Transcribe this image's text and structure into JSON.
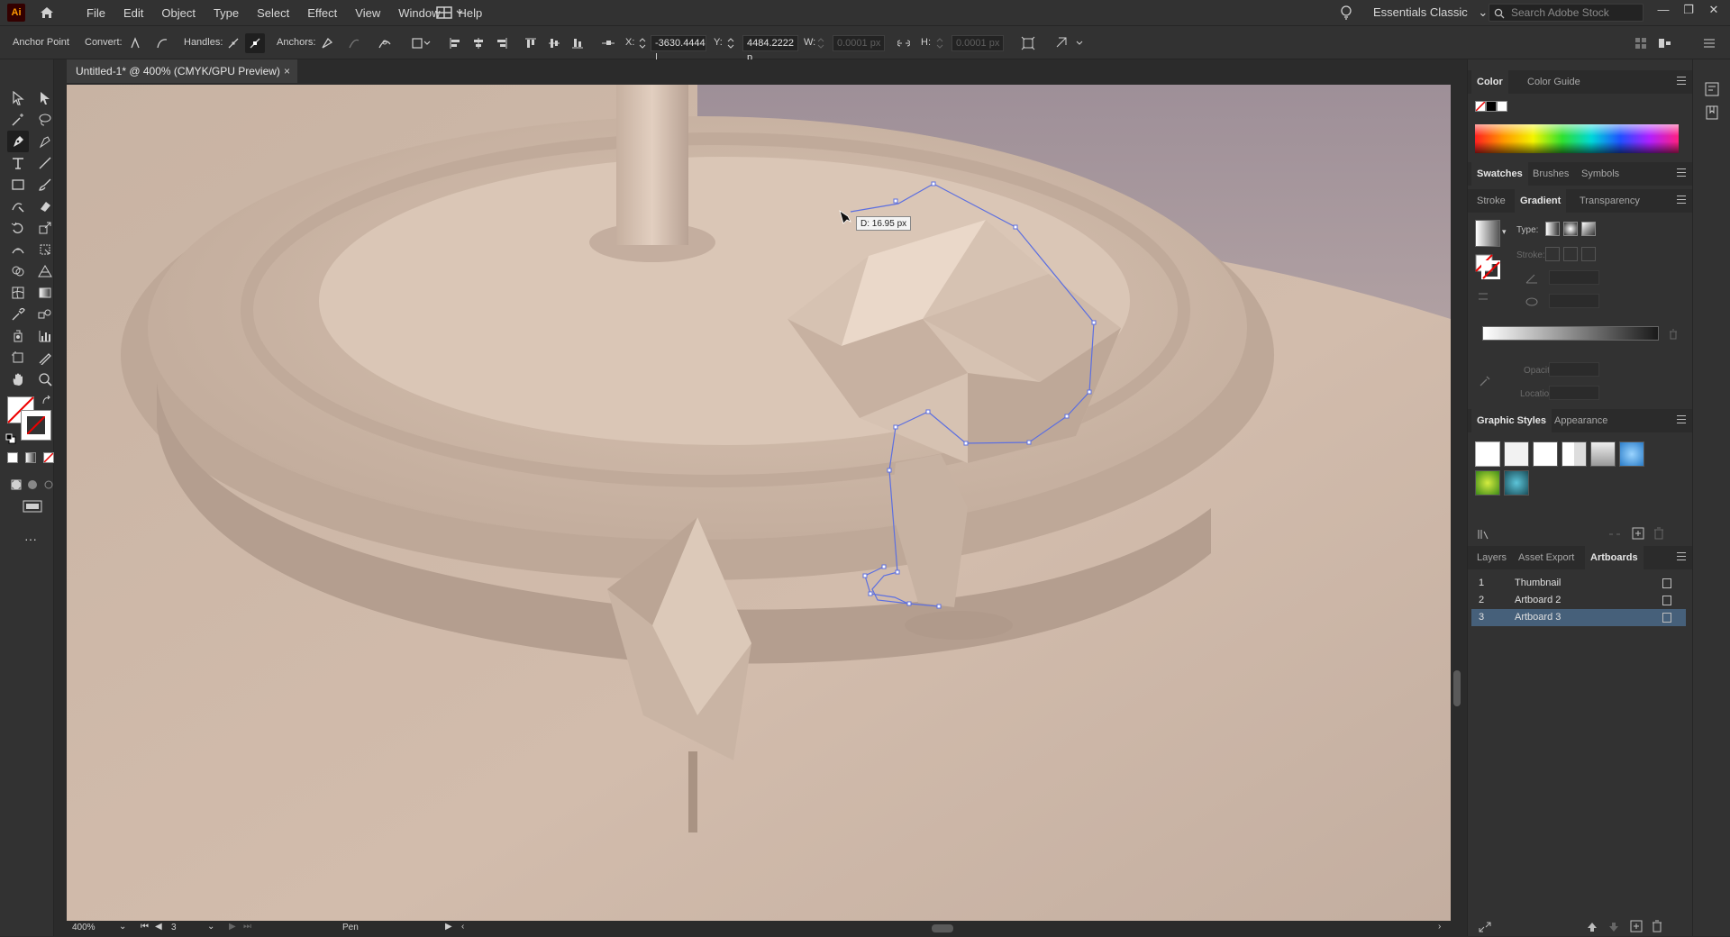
{
  "app": {
    "logo": "Ai",
    "menus": [
      "File",
      "Edit",
      "Object",
      "Type",
      "Select",
      "Effect",
      "View",
      "Window",
      "Help"
    ],
    "workspace": "Essentials Classic",
    "search_placeholder": "Search Adobe Stock"
  },
  "control_bar": {
    "mode_label": "Anchor Point",
    "convert_label": "Convert:",
    "handles_label": "Handles:",
    "anchors_label": "Anchors:",
    "x_label": "X:",
    "x_value": "-3630.4444 |",
    "y_label": "Y:",
    "y_value": "4484.2222 p",
    "w_label": "W:",
    "w_value": "0.0001 px",
    "h_label": "H:",
    "h_value": "0.0001 px"
  },
  "document": {
    "tab_title": "Untitled-1* @ 400% (CMYK/GPU Preview)",
    "close_glyph": "×",
    "tooltip": "D: 16.95 px"
  },
  "status_bar": {
    "zoom": "400%",
    "artboard_number": "3",
    "current_tool": "Pen"
  },
  "panels": {
    "color_tabs": [
      "Color",
      "Color Guide"
    ],
    "swatch_tabs": [
      "Swatches",
      "Brushes",
      "Symbols"
    ],
    "gradient_tabs": [
      "Stroke",
      "Gradient",
      "Transparency"
    ],
    "gradient_labels": {
      "type": "Type:",
      "stroke": "Stroke:",
      "opacity": "Opacity:",
      "location": "Location:"
    },
    "style_tabs": [
      "Graphic Styles",
      "Appearance"
    ],
    "layer_tabs": [
      "Layers",
      "Asset Export",
      "Artboards"
    ],
    "artboards": [
      {
        "num": "1",
        "name": "Thumbnail",
        "selected": false
      },
      {
        "num": "2",
        "name": "Artboard 2",
        "selected": false
      },
      {
        "num": "3",
        "name": "Artboard 3",
        "selected": true
      }
    ]
  },
  "colors": {
    "selection_path": "#5c6fe0",
    "artboard_selected": "#46607a",
    "app_dark": "#323232",
    "canvas_tone": "#cdb8a8"
  }
}
